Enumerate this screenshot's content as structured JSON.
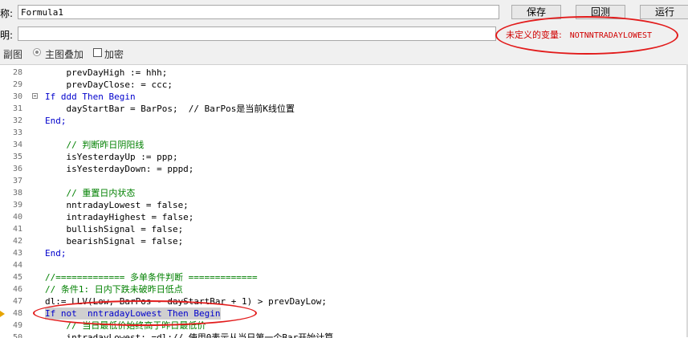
{
  "form": {
    "name_label": "称:",
    "name_value": "Formula1",
    "desc_label": "明:",
    "desc_value": ""
  },
  "toolbar": {
    "save_label": "保存",
    "backtest_label": "回测",
    "run_label": "运行"
  },
  "error": {
    "message": "未定义的变量:",
    "variable": "NOTNNTRADAYLOWEST"
  },
  "options": {
    "sub_chart": "副图",
    "main_overlay": "主图叠加",
    "encrypt": "加密"
  },
  "code_lines": [
    {
      "n": "28",
      "t": "    prevDayHigh := hhh;"
    },
    {
      "n": "29",
      "t": "    prevDayClose: = ccc;"
    },
    {
      "n": "30",
      "t": "If ddd Then Begin"
    },
    {
      "n": "31",
      "t": "    dayStartBar = BarPos;  // BarPos是当前K线位置"
    },
    {
      "n": "32",
      "t": "End;"
    },
    {
      "n": "33",
      "t": ""
    },
    {
      "n": "34",
      "t": "    // 判断昨日阴阳线"
    },
    {
      "n": "35",
      "t": "    isYesterdayUp := ppp;"
    },
    {
      "n": "36",
      "t": "    isYesterdayDown: = pppd;"
    },
    {
      "n": "37",
      "t": ""
    },
    {
      "n": "38",
      "t": "    // 重置日内状态"
    },
    {
      "n": "39",
      "t": "    nntradayLowest = false;"
    },
    {
      "n": "40",
      "t": "    intradayHighest = false;"
    },
    {
      "n": "41",
      "t": "    bullishSignal = false;"
    },
    {
      "n": "42",
      "t": "    bearishSignal = false;"
    },
    {
      "n": "43",
      "t": "End;"
    },
    {
      "n": "44",
      "t": ""
    },
    {
      "n": "45",
      "t": "//============= 多单条件判断 ============="
    },
    {
      "n": "46",
      "t": "// 条件1: 日内下跌未破昨日低点"
    },
    {
      "n": "47",
      "t": "dl:= LLV(Low, BarPos - dayStartBar + 1) > prevDayLow;"
    },
    {
      "n": "48",
      "t": "If not  nntradayLowest Then Begin"
    },
    {
      "n": "49",
      "t": "    // 当日最低价始终高于昨日最低价"
    },
    {
      "n": "50",
      "t": "    intradayLowest: =dl;// 使用0表示从当日第一个Bar开始计算"
    }
  ]
}
